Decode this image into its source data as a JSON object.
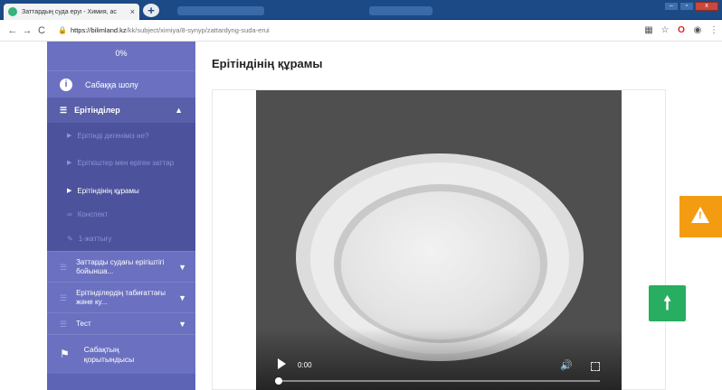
{
  "browser": {
    "tab_title": "Заттардың суда еруі - Химия, ас",
    "tab_close": "×",
    "new_tab": "+",
    "back": "←",
    "forward": "→",
    "reload": "C",
    "url_host": "https://bilimland.kz",
    "url_path": "/kk/subject/ximiya/8-synyp/zattardyng-suda-erui",
    "win_min": "–",
    "win_max": "▫",
    "win_close": "x"
  },
  "sidebar": {
    "progress": "0%",
    "overview_label": "Сабаққа шолу",
    "section_label": "Ерітінділер",
    "sub_items": [
      "Ерітінді дегеніміз не?",
      "Еріткіштер мен еріген заттар",
      "Ерітіндінің құрамы",
      "Конспект",
      "1-жаттығу"
    ],
    "groups": [
      "Заттарды судағы ерігіштігі бойынша...",
      "Ерітінділердің табиғаттағы және ку...",
      "Тест"
    ],
    "result_label": "Сабақтың қорытындысы"
  },
  "main": {
    "title": "Ерітіндінің құрамы",
    "video": {
      "time": "0:00",
      "progress": 0
    }
  },
  "colors": {
    "sidebar": "#5d64b5",
    "warning": "#f39c12",
    "scroll_top": "#27ae60"
  },
  "icons": {
    "warning": "warning-icon",
    "scroll_top": "arrow-up-icon"
  }
}
